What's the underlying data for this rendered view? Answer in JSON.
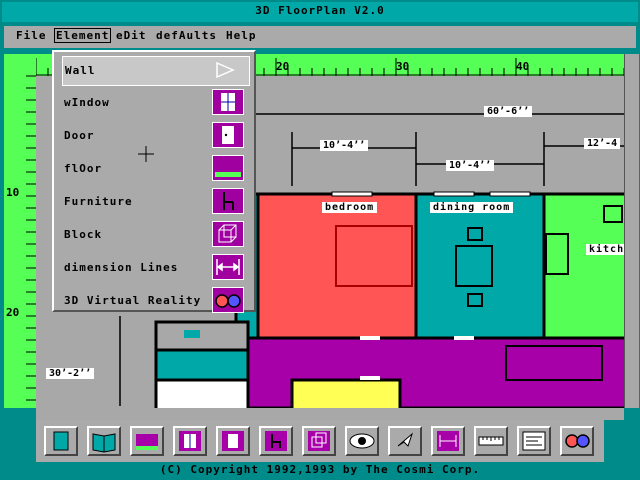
{
  "app": {
    "title": "3D FloorPlan  V2.0"
  },
  "menu": {
    "items": [
      {
        "label": "File"
      },
      {
        "label": "Element"
      },
      {
        "label": "eDit"
      },
      {
        "label": "defAults"
      },
      {
        "label": "Help"
      }
    ]
  },
  "ruler": {
    "top_labels": [
      "20",
      "30",
      "40"
    ],
    "left_labels": [
      "10",
      "20"
    ]
  },
  "dropdown": {
    "items": [
      {
        "label": "Wall",
        "icon": "arrow-right-icon"
      },
      {
        "label": "wIndow",
        "icon": "window-icon"
      },
      {
        "label": "Door",
        "icon": "door-icon"
      },
      {
        "label": "flOor",
        "icon": "floor-icon"
      },
      {
        "label": "Furniture",
        "icon": "chair-icon"
      },
      {
        "label": "Block",
        "icon": "cube-icon"
      },
      {
        "label": "dimension Lines",
        "icon": "dimension-icon"
      },
      {
        "label": "3D Virtual Reality",
        "icon": "glasses-icon"
      }
    ]
  },
  "plan": {
    "dims": [
      "60’-6’’",
      "10’-4’’",
      "10’-4’’",
      "12’-4",
      "30’-2’’"
    ],
    "rooms": [
      "bedroom",
      "dining room",
      "kitch"
    ]
  },
  "toolbar": {
    "tools": [
      "book-closed-icon",
      "book-open-icon",
      "floor-icon",
      "window-icon",
      "door-icon",
      "chair-icon",
      "cube-icon",
      "eye-icon",
      "pointer-icon",
      "dimension-icon",
      "ruler-icon",
      "text-icon",
      "glasses-icon"
    ]
  },
  "status": {
    "copyright": "(C) Copyright 1992,1993  by The Cosmi Corp."
  },
  "colors": {
    "bedroom": "#ff5555",
    "dining": "#00a8a8",
    "kitchen": "#55ff55",
    "hall": "#a800a8",
    "ruler": "#55ff55"
  }
}
